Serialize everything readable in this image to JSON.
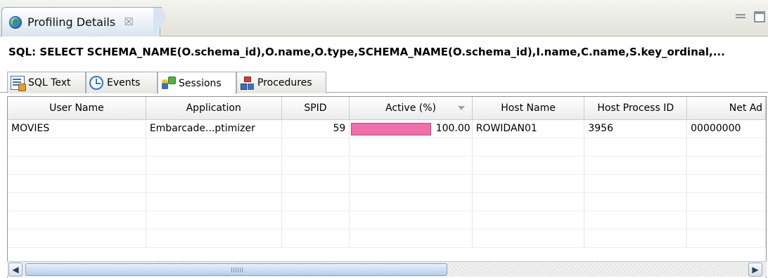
{
  "view": {
    "title": "Profiling Details",
    "close_glyph": "☒",
    "icon": "globe-icon"
  },
  "sql": {
    "text": "SQL: SELECT SCHEMA_NAME(O.schema_id),O.name,O.type,SCHEMA_NAME(O.schema_id),I.name,C.name,S.key_ordinal,..."
  },
  "tabs": [
    {
      "label": "SQL Text",
      "icon": "sql-text-icon"
    },
    {
      "label": "Events",
      "icon": "clock-icon"
    },
    {
      "label": "Sessions",
      "icon": "sessions-icon",
      "active": true
    },
    {
      "label": "Procedures",
      "icon": "procedures-icon"
    }
  ],
  "table": {
    "columns": [
      "User Name",
      "Application",
      "SPID",
      "Active (%)",
      "Host Name",
      "Host Process ID",
      "Net Ad"
    ],
    "rows": [
      {
        "user_name": "MOVIES",
        "application": "Embarcade...ptimizer",
        "spid": "59",
        "active_pct": "100.00",
        "host_name": "ROWIDAN01",
        "host_process_id": "3956",
        "net_address": "00000000"
      }
    ],
    "active_bar_color": "#ef6fa8",
    "active_fraction": 1.0,
    "empty_rows": 6
  },
  "scrollbar": {
    "left_arrow": "◀",
    "right_arrow": "▶",
    "grip": "III"
  },
  "colors": {
    "tab_gradient_top": "#ffffff",
    "tab_gradient_bottom": "#d8e4f0",
    "border": "#8c949e"
  }
}
